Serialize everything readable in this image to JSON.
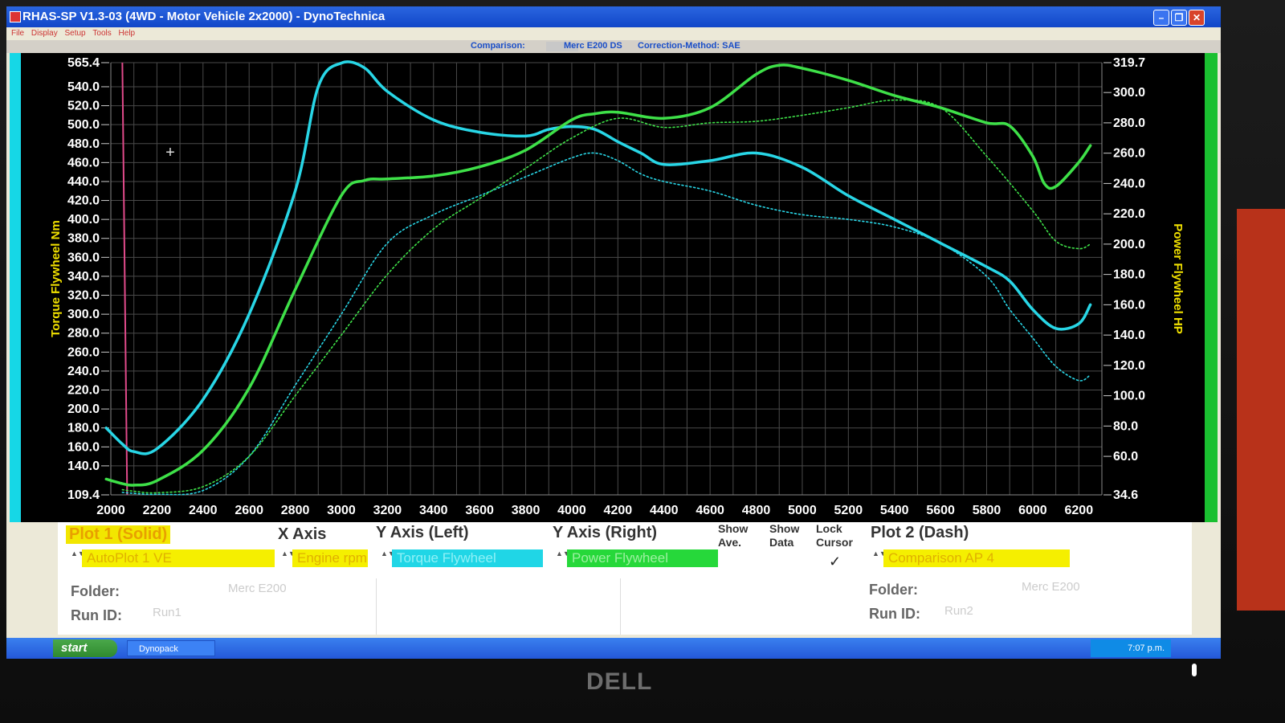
{
  "window": {
    "title": "RHAS-SP V1.3-03  (4WD - Motor Vehicle 2x2000) - DynoTechnica",
    "menu": [
      "File",
      "Display",
      "Setup",
      "Tools",
      "Help"
    ],
    "minimize_glyph": "–",
    "maximize_glyph": "❐",
    "close_glyph": "✕"
  },
  "infobar": {
    "comparison_label": "Comparison:",
    "vehicle": "Merc E200 DS",
    "correction": "Correction-Method: SAE"
  },
  "colors": {
    "torque": "#28d6e6",
    "power": "#3ee048",
    "grid": "#4a4a4a",
    "cursor": "#e04a8a",
    "axis_text": "#ffffff",
    "axis_title": "#f0e000"
  },
  "chart_data": {
    "type": "line",
    "xlabel": "",
    "ylabel_left": "Torque Flywheel Nm",
    "ylabel_right": "Power Flywheel HP",
    "xlim": [
      2000,
      6300
    ],
    "ylim_left": [
      109.4,
      565.4
    ],
    "ylim_right": [
      34.6,
      319.7
    ],
    "x_ticks": [
      2000,
      2200,
      2400,
      2600,
      2800,
      3000,
      3200,
      3400,
      3600,
      3800,
      4000,
      4200,
      4400,
      4600,
      4800,
      5000,
      5200,
      5400,
      5600,
      5800,
      6000,
      6200
    ],
    "y_left_ticks": [
      "109.4",
      "140.0",
      "160.0",
      "180.0",
      "200.0",
      "220.0",
      "240.0",
      "260.0",
      "280.0",
      "300.0",
      "320.0",
      "340.0",
      "360.0",
      "380.0",
      "400.0",
      "420.0",
      "440.0",
      "460.0",
      "480.0",
      "500.0",
      "520.0",
      "540.0",
      "565.4"
    ],
    "y_right_ticks": [
      "34.6",
      "60.0",
      "80.0",
      "100.0",
      "120.0",
      "140.0",
      "160.0",
      "180.0",
      "200.0",
      "220.0",
      "240.0",
      "260.0",
      "280.0",
      "300.0",
      "319.7"
    ],
    "grid": true,
    "cursor_rpm": 2050,
    "series": [
      {
        "name": "Torque Flywheel",
        "style": "solid",
        "axis": "left",
        "x": [
          1980,
          2050,
          2100,
          2200,
          2400,
          2600,
          2800,
          2900,
          3000,
          3100,
          3200,
          3400,
          3600,
          3800,
          3900,
          4000,
          4100,
          4200,
          4300,
          4400,
          4600,
          4800,
          5000,
          5200,
          5400,
          5600,
          5800,
          5900,
          6000,
          6100,
          6200,
          6250
        ],
        "y": [
          180,
          163,
          155,
          158,
          210,
          300,
          430,
          540,
          565,
          560,
          535,
          505,
          492,
          488,
          495,
          498,
          495,
          482,
          470,
          458,
          462,
          470,
          455,
          425,
          400,
          375,
          350,
          335,
          305,
          285,
          290,
          310
        ]
      },
      {
        "name": "Power Flywheel",
        "style": "solid",
        "axis": "right",
        "x": [
          1980,
          2050,
          2100,
          2200,
          2400,
          2600,
          2800,
          3000,
          3100,
          3200,
          3400,
          3600,
          3800,
          4000,
          4100,
          4200,
          4400,
          4600,
          4800,
          4900,
          5000,
          5200,
          5400,
          5600,
          5800,
          5900,
          6000,
          6050,
          6100,
          6200,
          6250
        ],
        "y": [
          45,
          42,
          41,
          44,
          64,
          105,
          170,
          232,
          242,
          243,
          245,
          251,
          262,
          282,
          286,
          287,
          283,
          290,
          312,
          318,
          316,
          308,
          298,
          290,
          280,
          278,
          258,
          240,
          238,
          254,
          265
        ]
      },
      {
        "name": "Comparison Torque",
        "style": "dash",
        "axis": "left",
        "x": [
          2050,
          2100,
          2200,
          2400,
          2600,
          2800,
          3000,
          3200,
          3400,
          3600,
          3800,
          4000,
          4100,
          4200,
          4300,
          4400,
          4600,
          4800,
          5000,
          5200,
          5400,
          5600,
          5800,
          5900,
          6000,
          6100,
          6200,
          6250
        ],
        "y": [
          112,
          111,
          110,
          114,
          150,
          225,
          300,
          375,
          405,
          425,
          445,
          465,
          470,
          462,
          448,
          440,
          430,
          415,
          405,
          400,
          392,
          375,
          340,
          305,
          275,
          245,
          230,
          236
        ]
      },
      {
        "name": "Comparison Power",
        "style": "dash",
        "axis": "right",
        "x": [
          2050,
          2100,
          2200,
          2400,
          2600,
          2800,
          3000,
          3200,
          3400,
          3600,
          3800,
          4000,
          4200,
          4400,
          4600,
          4800,
          5000,
          5200,
          5400,
          5600,
          5800,
          6000,
          6100,
          6200,
          6250
        ],
        "y": [
          38,
          37,
          36,
          40,
          60,
          100,
          140,
          180,
          210,
          230,
          250,
          270,
          283,
          277,
          280,
          281,
          285,
          290,
          295,
          290,
          258,
          222,
          202,
          197,
          200
        ]
      }
    ]
  },
  "controls": {
    "plot1_label": "Plot 1 (Solid)",
    "plot1_value": "AutoPlot 1 VE",
    "xaxis_label": "X Axis",
    "xaxis_value": "Engine rpm",
    "yleft_label": "Y Axis (Left)",
    "yleft_value": "Torque Flywheel",
    "yright_label": "Y Axis (Right)",
    "yright_value": "Power Flywheel",
    "show_ave_label_1": "Show",
    "show_ave_label_2": "Ave.",
    "show_data_label_1": "Show",
    "show_data_label_2": "Data",
    "lock_cursor_label_1": "Lock",
    "lock_cursor_label_2": "Cursor",
    "lock_cursor_check": "✓",
    "plot2_label": "Plot 2 (Dash)",
    "plot2_value": "Comparison AP 4",
    "folder_label": "Folder:",
    "folder1_value": "Merc E200",
    "runid_label": "Run ID:",
    "runid1_value": "Run1",
    "folder2_value": "Merc E200",
    "runid2_value": "Run2",
    "spin_glyph": "▲▼"
  },
  "taskbar": {
    "start": "start",
    "task": "Dynopack",
    "clock": "7:07 p.m."
  },
  "monitor": {
    "brand": "DELL"
  }
}
